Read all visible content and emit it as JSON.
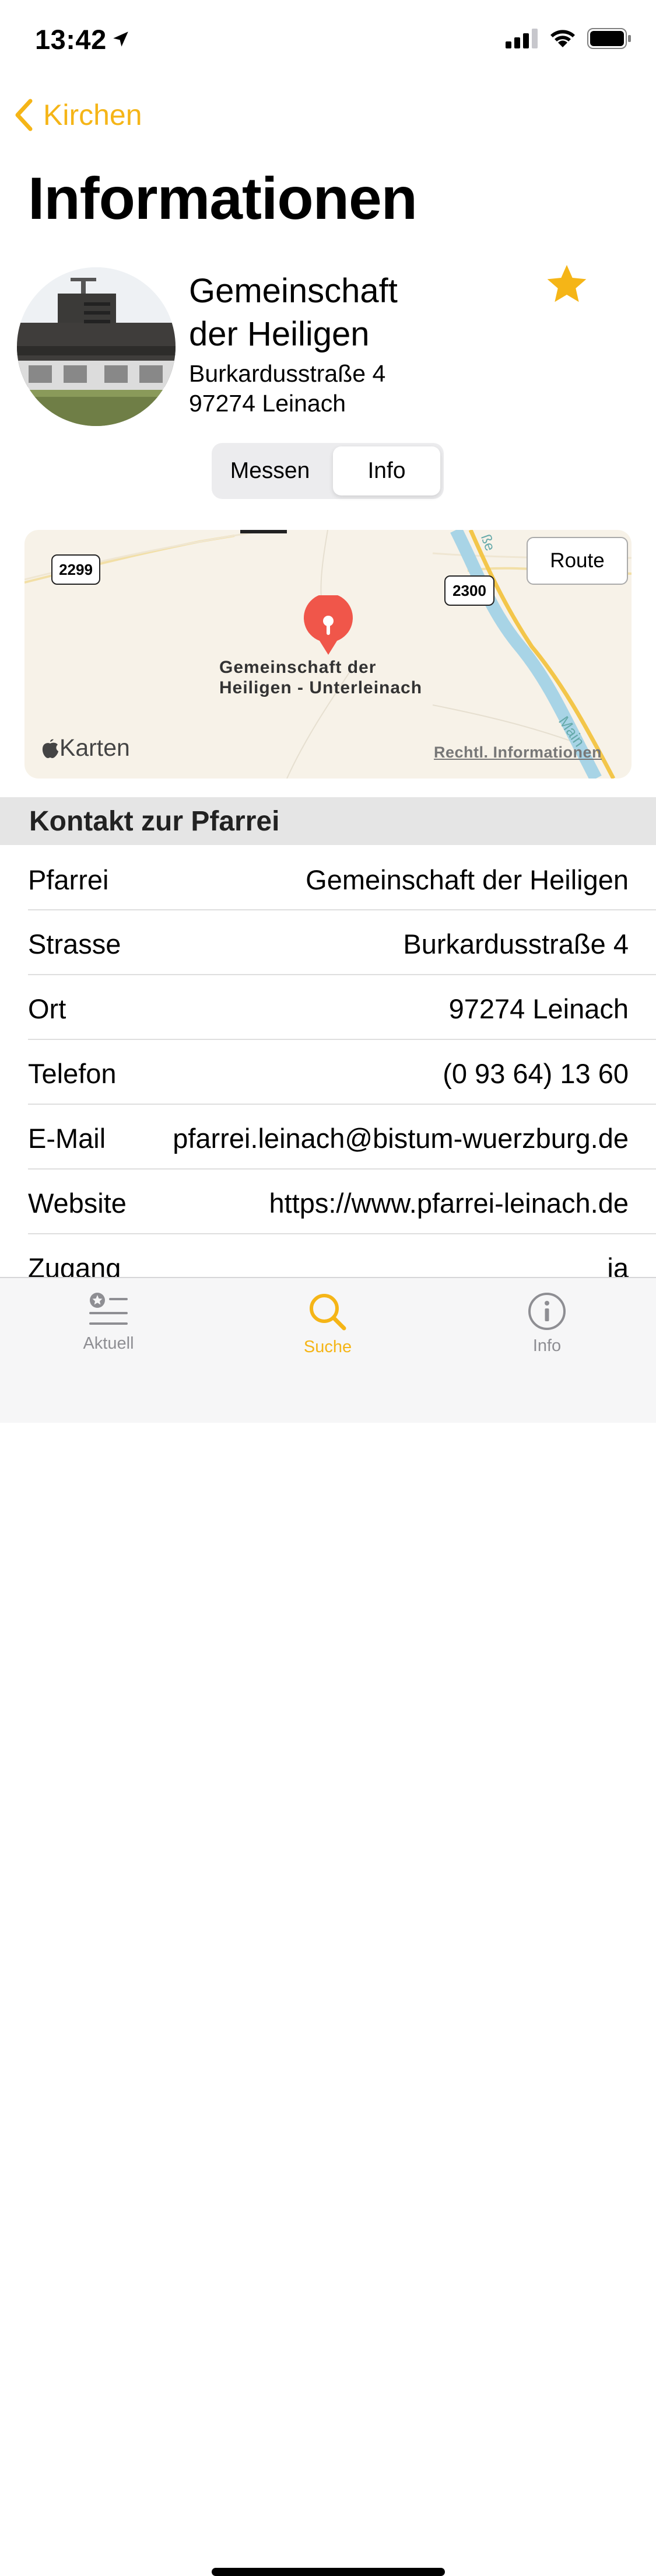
{
  "status_bar": {
    "time": "13:42"
  },
  "nav": {
    "back_label": "Kirchen",
    "title": "Informationen"
  },
  "church": {
    "name": "Gemeinschaft der Heiligen",
    "street": "Burkardusstraße 4",
    "city": "97274 Leinach",
    "favorite": true
  },
  "segment": {
    "options": [
      "Messen",
      "Info"
    ],
    "selected": "Info"
  },
  "map": {
    "route_label": "Route",
    "pin_label_line1": "Gemeinschaft der",
    "pin_label_line2": "Heiligen - Unterleinach",
    "road_1": "2299",
    "road_2": "2300",
    "river": "Main",
    "river_partial": "ße",
    "brand": "Karten",
    "legal": "Rechtl. Informationen"
  },
  "contact": {
    "header": "Kontakt zur Pfarrei",
    "rows": [
      {
        "label": "Pfarrei",
        "value": "Gemeinschaft der Heiligen"
      },
      {
        "label": "Strasse",
        "value": "Burkardusstraße 4"
      },
      {
        "label": "Ort",
        "value": "97274 Leinach"
      },
      {
        "label": "Telefon",
        "value": "(0 93 64) 13 60"
      },
      {
        "label": "E-Mail",
        "value": "pfarrei.leinach@bistum-wuerzburg.de"
      },
      {
        "label": "Website",
        "value": "https://www.pfarrei-leinach.de"
      },
      {
        "label": "Zugang",
        "value": "ja"
      }
    ]
  },
  "tabbar": {
    "items": [
      {
        "label": "Aktuell",
        "icon": "list-star-icon"
      },
      {
        "label": "Suche",
        "icon": "search-icon",
        "active": true
      },
      {
        "label": "Info",
        "icon": "info-icon"
      }
    ]
  },
  "colors": {
    "accent": "#F5B517",
    "pin": "#F0564A",
    "inactive": "#8e8e93"
  }
}
